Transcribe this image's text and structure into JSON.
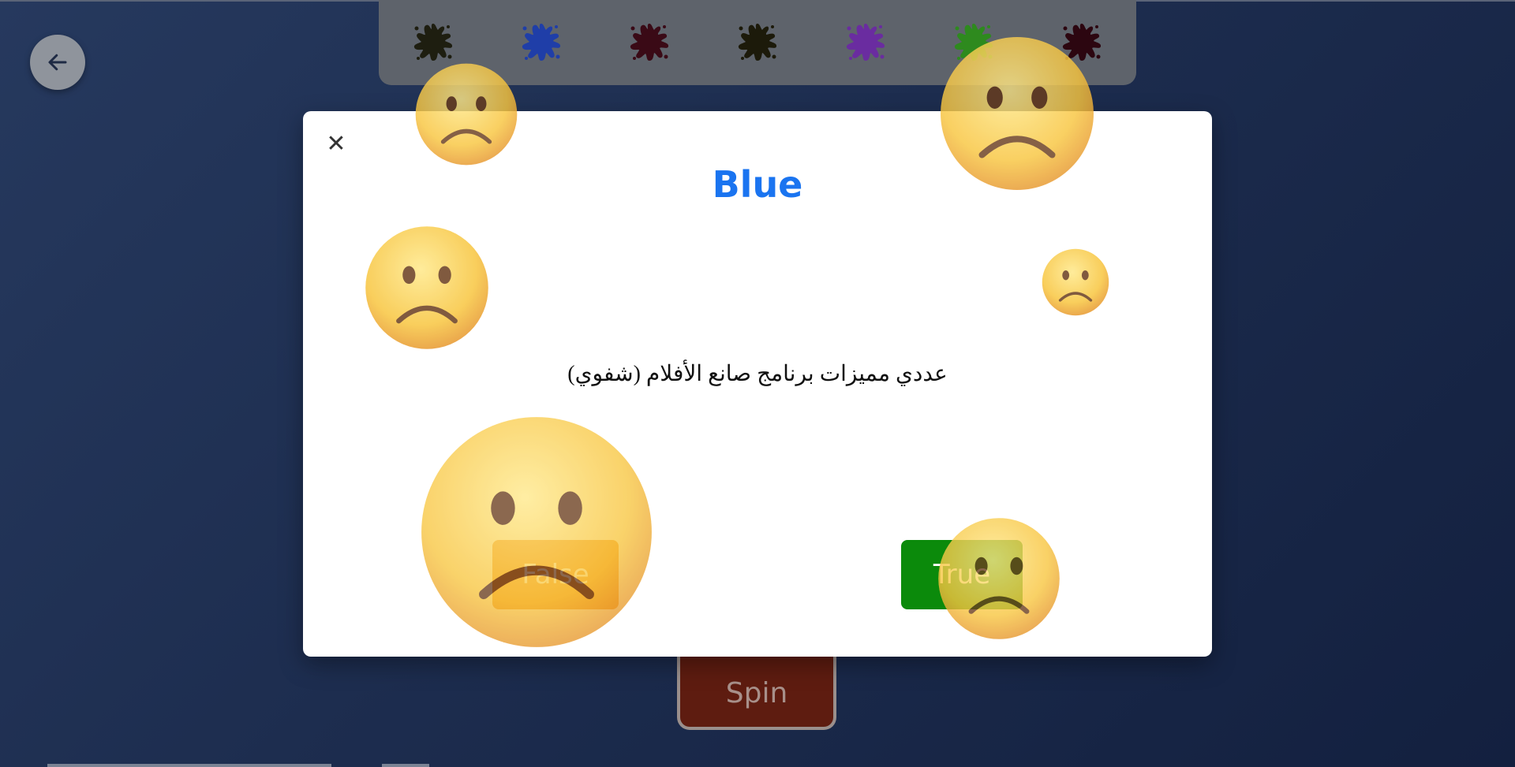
{
  "back_button": {
    "icon": "arrow-left-icon"
  },
  "paint_bar": {
    "splats": [
      {
        "name": "black",
        "color": "#1e1e10"
      },
      {
        "name": "blue",
        "color": "#1f3ea8"
      },
      {
        "name": "maroon",
        "color": "#3a0a16"
      },
      {
        "name": "black",
        "color": "#1c1a0a"
      },
      {
        "name": "purple",
        "color": "#6a2ca0"
      },
      {
        "name": "green",
        "color": "#2e8a1e"
      },
      {
        "name": "maroon",
        "color": "#2c0610"
      }
    ]
  },
  "modal": {
    "close_label": "✕",
    "title": "Blue",
    "question": "عددي مميزات برنامج صانع الأفلام (شفوي)",
    "false_label": "False",
    "true_label": "True"
  },
  "spin_button": {
    "label": "Spin"
  },
  "colors": {
    "title": "#1a74f0",
    "false_button": "#f08a1c",
    "true_button": "#0b8a0b",
    "background": "#1d2d4f"
  },
  "overlay_icons": [
    "sad-face-emoji"
  ]
}
